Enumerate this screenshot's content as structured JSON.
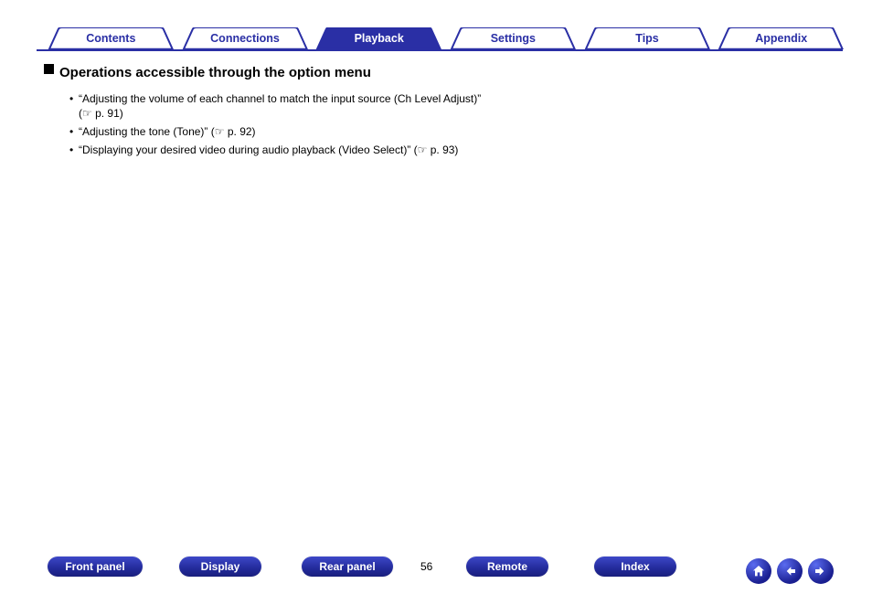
{
  "tabs": [
    {
      "label": "Contents",
      "active": false
    },
    {
      "label": "Connections",
      "active": false
    },
    {
      "label": "Playback",
      "active": true
    },
    {
      "label": "Settings",
      "active": false
    },
    {
      "label": "Tips",
      "active": false
    },
    {
      "label": "Appendix",
      "active": false
    }
  ],
  "heading": "Operations accessible through the option menu",
  "items": [
    {
      "text": "“Adjusting the volume of each channel to match the input source (Ch Level Adjust)”",
      "ref": "p. 91"
    },
    {
      "text": "“Adjusting the tone (Tone)”",
      "ref": "p. 92"
    },
    {
      "text": "“Displaying your desired video during audio playback (Video Select)”",
      "ref": "p. 93"
    }
  ],
  "bottom_buttons": {
    "b0": "Front panel",
    "b1": "Display",
    "b2": "Rear panel",
    "b3": "Remote",
    "b4": "Index"
  },
  "page_number": "56",
  "nav": {
    "home": "home-icon",
    "back": "arrow-left-icon",
    "forward": "arrow-right-icon"
  }
}
